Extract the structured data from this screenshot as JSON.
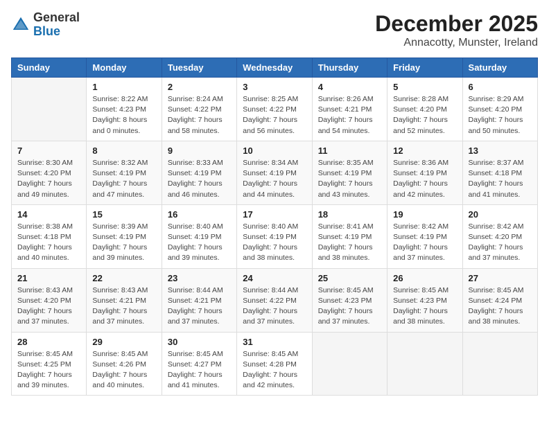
{
  "logo": {
    "general": "General",
    "blue": "Blue"
  },
  "title": "December 2025",
  "subtitle": "Annacotty, Munster, Ireland",
  "weekdays": [
    "Sunday",
    "Monday",
    "Tuesday",
    "Wednesday",
    "Thursday",
    "Friday",
    "Saturday"
  ],
  "weeks": [
    [
      {
        "day": null
      },
      {
        "day": 1,
        "sunrise": "8:22 AM",
        "sunset": "4:23 PM",
        "daylight": "8 hours and 0 minutes."
      },
      {
        "day": 2,
        "sunrise": "8:24 AM",
        "sunset": "4:22 PM",
        "daylight": "7 hours and 58 minutes."
      },
      {
        "day": 3,
        "sunrise": "8:25 AM",
        "sunset": "4:22 PM",
        "daylight": "7 hours and 56 minutes."
      },
      {
        "day": 4,
        "sunrise": "8:26 AM",
        "sunset": "4:21 PM",
        "daylight": "7 hours and 54 minutes."
      },
      {
        "day": 5,
        "sunrise": "8:28 AM",
        "sunset": "4:20 PM",
        "daylight": "7 hours and 52 minutes."
      },
      {
        "day": 6,
        "sunrise": "8:29 AM",
        "sunset": "4:20 PM",
        "daylight": "7 hours and 50 minutes."
      }
    ],
    [
      {
        "day": 7,
        "sunrise": "8:30 AM",
        "sunset": "4:20 PM",
        "daylight": "7 hours and 49 minutes."
      },
      {
        "day": 8,
        "sunrise": "8:32 AM",
        "sunset": "4:19 PM",
        "daylight": "7 hours and 47 minutes."
      },
      {
        "day": 9,
        "sunrise": "8:33 AM",
        "sunset": "4:19 PM",
        "daylight": "7 hours and 46 minutes."
      },
      {
        "day": 10,
        "sunrise": "8:34 AM",
        "sunset": "4:19 PM",
        "daylight": "7 hours and 44 minutes."
      },
      {
        "day": 11,
        "sunrise": "8:35 AM",
        "sunset": "4:19 PM",
        "daylight": "7 hours and 43 minutes."
      },
      {
        "day": 12,
        "sunrise": "8:36 AM",
        "sunset": "4:19 PM",
        "daylight": "7 hours and 42 minutes."
      },
      {
        "day": 13,
        "sunrise": "8:37 AM",
        "sunset": "4:18 PM",
        "daylight": "7 hours and 41 minutes."
      }
    ],
    [
      {
        "day": 14,
        "sunrise": "8:38 AM",
        "sunset": "4:18 PM",
        "daylight": "7 hours and 40 minutes."
      },
      {
        "day": 15,
        "sunrise": "8:39 AM",
        "sunset": "4:19 PM",
        "daylight": "7 hours and 39 minutes."
      },
      {
        "day": 16,
        "sunrise": "8:40 AM",
        "sunset": "4:19 PM",
        "daylight": "7 hours and 39 minutes."
      },
      {
        "day": 17,
        "sunrise": "8:40 AM",
        "sunset": "4:19 PM",
        "daylight": "7 hours and 38 minutes."
      },
      {
        "day": 18,
        "sunrise": "8:41 AM",
        "sunset": "4:19 PM",
        "daylight": "7 hours and 38 minutes."
      },
      {
        "day": 19,
        "sunrise": "8:42 AM",
        "sunset": "4:19 PM",
        "daylight": "7 hours and 37 minutes."
      },
      {
        "day": 20,
        "sunrise": "8:42 AM",
        "sunset": "4:20 PM",
        "daylight": "7 hours and 37 minutes."
      }
    ],
    [
      {
        "day": 21,
        "sunrise": "8:43 AM",
        "sunset": "4:20 PM",
        "daylight": "7 hours and 37 minutes."
      },
      {
        "day": 22,
        "sunrise": "8:43 AM",
        "sunset": "4:21 PM",
        "daylight": "7 hours and 37 minutes."
      },
      {
        "day": 23,
        "sunrise": "8:44 AM",
        "sunset": "4:21 PM",
        "daylight": "7 hours and 37 minutes."
      },
      {
        "day": 24,
        "sunrise": "8:44 AM",
        "sunset": "4:22 PM",
        "daylight": "7 hours and 37 minutes."
      },
      {
        "day": 25,
        "sunrise": "8:45 AM",
        "sunset": "4:23 PM",
        "daylight": "7 hours and 37 minutes."
      },
      {
        "day": 26,
        "sunrise": "8:45 AM",
        "sunset": "4:23 PM",
        "daylight": "7 hours and 38 minutes."
      },
      {
        "day": 27,
        "sunrise": "8:45 AM",
        "sunset": "4:24 PM",
        "daylight": "7 hours and 38 minutes."
      }
    ],
    [
      {
        "day": 28,
        "sunrise": "8:45 AM",
        "sunset": "4:25 PM",
        "daylight": "7 hours and 39 minutes."
      },
      {
        "day": 29,
        "sunrise": "8:45 AM",
        "sunset": "4:26 PM",
        "daylight": "7 hours and 40 minutes."
      },
      {
        "day": 30,
        "sunrise": "8:45 AM",
        "sunset": "4:27 PM",
        "daylight": "7 hours and 41 minutes."
      },
      {
        "day": 31,
        "sunrise": "8:45 AM",
        "sunset": "4:28 PM",
        "daylight": "7 hours and 42 minutes."
      },
      {
        "day": null
      },
      {
        "day": null
      },
      {
        "day": null
      }
    ]
  ],
  "labels": {
    "sunrise": "Sunrise:",
    "sunset": "Sunset:",
    "daylight": "Daylight:"
  }
}
